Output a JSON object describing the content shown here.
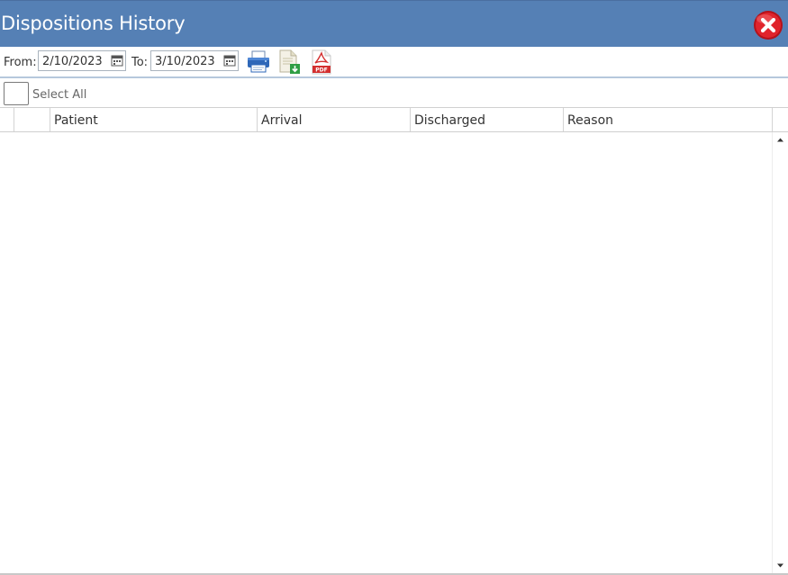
{
  "window": {
    "title": "Dispositions History"
  },
  "toolbar": {
    "from_label": "From:",
    "from_value": "2/10/2023",
    "to_label": "To:",
    "to_value": "3/10/2023",
    "icons": [
      "calendar-icon",
      "printer-icon",
      "export-document-icon",
      "pdf-icon"
    ]
  },
  "grid": {
    "select_all_label": "Select All",
    "columns": [
      "",
      "",
      "Patient",
      "Arrival",
      "Discharged",
      "Reason"
    ],
    "rows": []
  },
  "colors": {
    "titlebar": "#5580b5",
    "close_button": "#e0242c",
    "toolbar_border": "#b6c8dc"
  }
}
